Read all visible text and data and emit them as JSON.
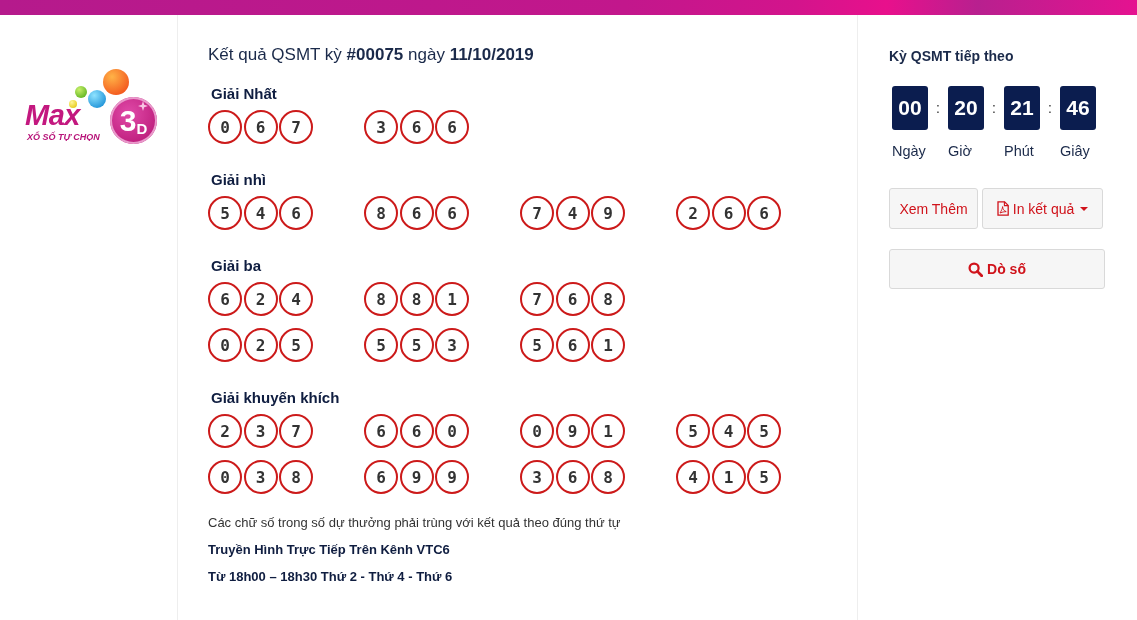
{
  "logo": {
    "wordmark": "Max",
    "badge": "3$_{D}$",
    "tagline": "XỔ SỐ TỰ CHỌN"
  },
  "result": {
    "title": "Kết quả QSMT kỳ **#00075** ngày **11/10/2019**",
    "prizes": [
      {
        "name": "Giải Nhất",
        "rows": [
          {
            "numbers": [
              [
                "0",
                "6",
                "7"
              ],
              [
                "3",
                "6",
                "6"
              ]
            ]
          }
        ]
      },
      {
        "name": "Giải nhì",
        "rows": [
          {
            "numbers": [
              [
                "5",
                "4",
                "6"
              ],
              [
                "8",
                "6",
                "6"
              ],
              [
                "7",
                "4",
                "9"
              ],
              [
                "2",
                "6",
                "6"
              ]
            ]
          }
        ]
      },
      {
        "name": "Giải ba",
        "rows": [
          {
            "numbers": [
              [
                "6",
                "2",
                "4"
              ],
              [
                "8",
                "8",
                "1"
              ],
              [
                "7",
                "6",
                "8"
              ]
            ]
          },
          {
            "numbers": [
              [
                "0",
                "2",
                "5"
              ],
              [
                "5",
                "5",
                "3"
              ],
              [
                "5",
                "6",
                "1"
              ]
            ]
          }
        ]
      },
      {
        "name": "Giải khuyến khích",
        "rows": [
          {
            "numbers": [
              [
                "2",
                "3",
                "7"
              ],
              [
                "6",
                "6",
                "0"
              ],
              [
                "0",
                "9",
                "1"
              ],
              [
                "5",
                "4",
                "5"
              ]
            ]
          },
          {
            "numbers": [
              [
                "0",
                "3",
                "8"
              ],
              [
                "6",
                "9",
                "9"
              ],
              [
                "3",
                "6",
                "8"
              ],
              [
                "4",
                "1",
                "5"
              ]
            ]
          }
        ]
      }
    ],
    "notes": [
      {
        "kind": "plain",
        "text": "Các chữ số trong số dự thưởng phải trùng với kết quả theo đúng thứ tự"
      },
      {
        "kind": "strong",
        "text": "Truyền Hình Trực Tiếp Trên Kênh VTC6"
      },
      {
        "kind": "strong",
        "text": "Từ 18h00 – 18h30 Thứ 2 - Thứ 4 - Thứ 6"
      }
    ]
  },
  "next_draw": {
    "title": "Kỳ QSMT tiếp theo",
    "countdown": [
      {
        "value": "00",
        "label": "Ngày",
        "separator": ":"
      },
      {
        "value": "20",
        "label": "Giờ",
        "separator": ":"
      },
      {
        "value": "21",
        "label": "Phút",
        "separator": ":"
      },
      {
        "value": "46",
        "label": "Giây"
      }
    ],
    "buttons": [
      {
        "kind": "plain",
        "label": "Xem Thêm"
      },
      {
        "kind": "print",
        "label": "In kết quả"
      },
      {
        "kind": "search",
        "label": "Dò số"
      }
    ]
  }
}
